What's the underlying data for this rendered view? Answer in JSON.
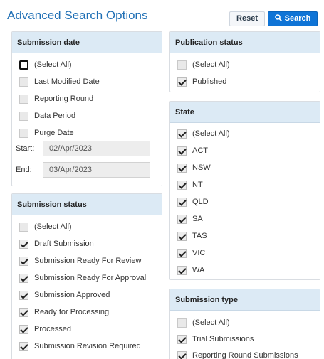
{
  "header": {
    "title": "Advanced Search Options",
    "reset_label": "Reset",
    "search_label": "Search",
    "search_icon": "search-icon"
  },
  "submission_date": {
    "heading": "Submission date",
    "items": [
      {
        "label": "(Select All)",
        "checked": false,
        "focused": true
      },
      {
        "label": "Last Modified Date",
        "checked": false
      },
      {
        "label": "Reporting Round",
        "checked": false
      },
      {
        "label": "Data Period",
        "checked": false
      },
      {
        "label": "Purge Date",
        "checked": false
      }
    ],
    "start_label": "Start:",
    "start_value": "02/Apr/2023",
    "end_label": "End:",
    "end_value": "03/Apr/2023"
  },
  "submission_status": {
    "heading": "Submission status",
    "items": [
      {
        "label": "(Select All)",
        "checked": false
      },
      {
        "label": "Draft Submission",
        "checked": true
      },
      {
        "label": "Submission Ready For Review",
        "checked": true
      },
      {
        "label": "Submission Ready For Approval",
        "checked": true
      },
      {
        "label": "Submission Approved",
        "checked": true
      },
      {
        "label": "Ready for Processing",
        "checked": true
      },
      {
        "label": "Processed",
        "checked": true
      },
      {
        "label": "Submission Revision Required",
        "checked": true
      }
    ]
  },
  "publication_status": {
    "heading": "Publication status",
    "items": [
      {
        "label": "(Select All)",
        "checked": false
      },
      {
        "label": "Published",
        "checked": true
      }
    ]
  },
  "state": {
    "heading": "State",
    "items": [
      {
        "label": "(Select All)",
        "checked": true
      },
      {
        "label": "ACT",
        "checked": true
      },
      {
        "label": "NSW",
        "checked": true
      },
      {
        "label": "NT",
        "checked": true
      },
      {
        "label": "QLD",
        "checked": true
      },
      {
        "label": "SA",
        "checked": true
      },
      {
        "label": "TAS",
        "checked": true
      },
      {
        "label": "VIC",
        "checked": true
      },
      {
        "label": "WA",
        "checked": true
      }
    ]
  },
  "submission_type": {
    "heading": "Submission type",
    "items": [
      {
        "label": "(Select All)",
        "checked": false
      },
      {
        "label": "Trial Submissions",
        "checked": true
      },
      {
        "label": "Reporting Round Submissions",
        "checked": true
      }
    ]
  }
}
